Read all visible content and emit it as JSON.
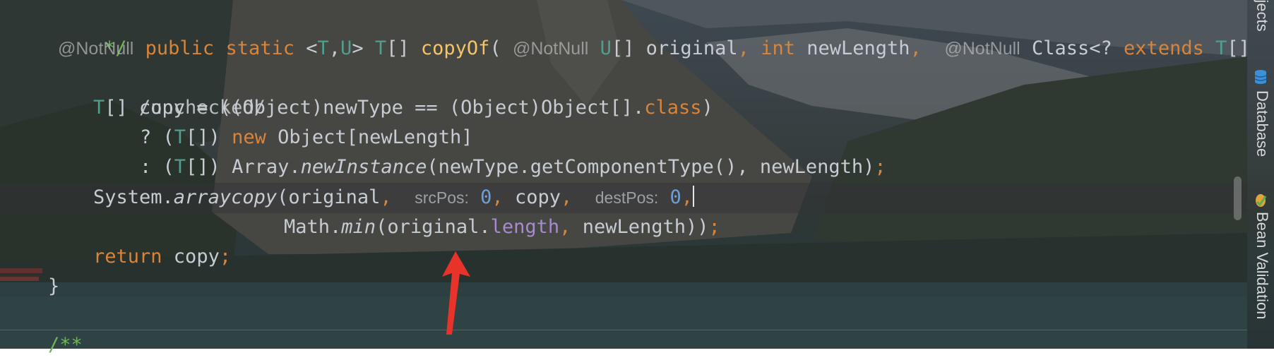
{
  "code": {
    "line1": {
      "text": "*/"
    },
    "line2": {
      "ann1": "@NotNull",
      "kw_public": "public",
      "kw_static": "static",
      "generics_open": "<",
      "t1": "T",
      "comma": ",",
      "u1": "U",
      "generics_close": ">",
      "ret_t": "T",
      "ret_arr": "[]",
      "method": "copyOf",
      "paren_open": "(",
      "ann2": "@NotNull",
      "p1_type": "U",
      "p1_arr": "[]",
      "p1_name": "original",
      "p1_comma": ",",
      "kw_int": "int",
      "p2_name": "newLength",
      "p2_comma": ",",
      "ann3": "@NotNull",
      "p3_type": "Class<?",
      "kw_extends": "extends",
      "p3_t": "T",
      "p3_arr": "[]"
    },
    "line3": {
      "text": "/unchecked/"
    },
    "line4": {
      "t": "T",
      "rest": "[] copy = ((Object)newType == (Object)Object[].",
      "kw_class": "class",
      "close": ")"
    },
    "line5": {
      "q": "? (",
      "t": "T",
      "mid": "[]) ",
      "kw_new": "new",
      "rest": " Object[newLength]"
    },
    "line6": {
      "c": ": (",
      "t": "T",
      "mid": "[]) Array.",
      "method": "newInstance",
      "rest": "(newType.getComponentType(), newLength)",
      "semi": ";"
    },
    "line7": {
      "pre": "System.",
      "method": "arraycopy",
      "open": "(original",
      "comma1": ",",
      "hint1": "srcPos:",
      "num1": "0",
      "comma2": ",",
      "mid": " copy",
      "comma3": ",",
      "hint2": "destPos:",
      "num2": "0",
      "comma4": ","
    },
    "line8": {
      "pre": "Math.",
      "method": "min",
      "open": "(original.",
      "field": "length",
      "comma": ",",
      "rest": " newLength))",
      "semi": ";"
    },
    "line9": {
      "kw_return": "return",
      "rest": " copy",
      "semi": ";"
    },
    "line10": {
      "text": "}"
    },
    "line11": {
      "text": "/**"
    }
  },
  "tool_strip": {
    "objects_tab": "Objects",
    "database_tab": "Database",
    "bean_validation_tab": "Bean Validation"
  },
  "colors": {
    "keyword": "#d8843a",
    "type_param": "#4f9e8e",
    "method_decl": "#f5c468",
    "comment": "#6fb45b",
    "number": "#6e9fd3",
    "field": "#a78bcf",
    "arrow": "#e8332a"
  }
}
